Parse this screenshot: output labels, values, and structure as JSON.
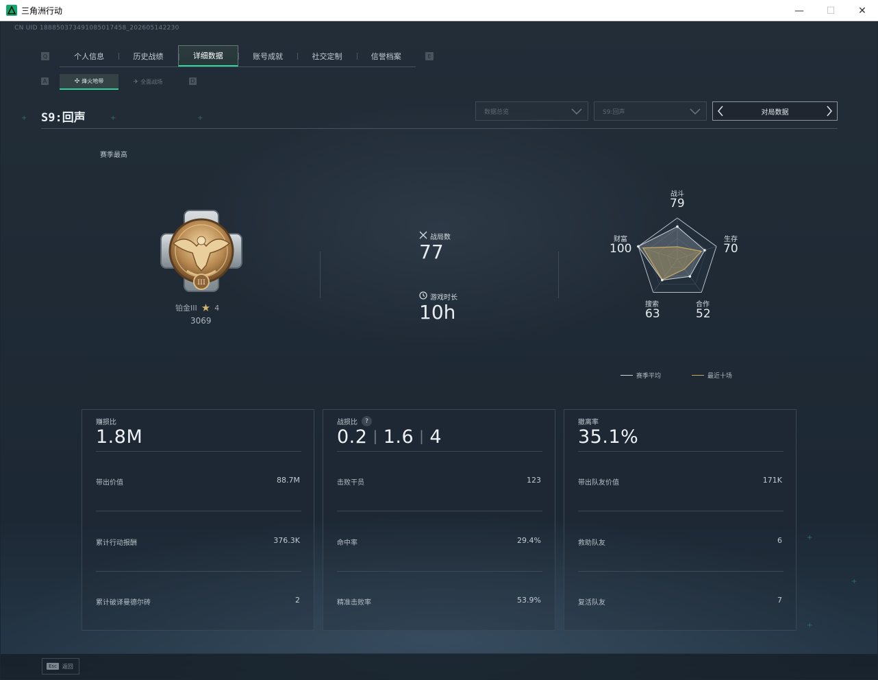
{
  "window": {
    "title": "三角洲行动",
    "minimize": "—",
    "maximize": "☐",
    "close": "✕"
  },
  "uid": "CN UID 188850373491085017458_202605142230",
  "key_hints": {
    "left_main": "Q",
    "right_main": "E",
    "left_sub": "A",
    "right_sub": "D"
  },
  "main_tabs": [
    {
      "label": "个人信息",
      "active": false
    },
    {
      "label": "历史战绩",
      "active": false
    },
    {
      "label": "详细数据",
      "active": true
    },
    {
      "label": "账号成就",
      "active": false
    },
    {
      "label": "社交定制",
      "active": false
    },
    {
      "label": "信誉档案",
      "active": false
    }
  ],
  "sub_tabs": [
    {
      "label": "烽火地带",
      "icon": "crosshair-icon",
      "active": true
    },
    {
      "label": "全面战场",
      "icon": "plane-icon",
      "active": false
    }
  ],
  "season": {
    "title": "S9:回声"
  },
  "filters": {
    "data_select": "数据总览",
    "season_select": "S9:回声",
    "match_button": "对局数据"
  },
  "season_best_label": "赛季最高",
  "rank": {
    "name": "铂金III",
    "stars": "4",
    "points": "3069"
  },
  "stats": {
    "matches_label": "战局数",
    "matches_value": "77",
    "playtime_label": "游戏时长",
    "playtime_value": "10h"
  },
  "radar": {
    "axes": [
      {
        "label": "战斗",
        "value": "79"
      },
      {
        "label": "生存",
        "value": "70"
      },
      {
        "label": "合作",
        "value": "52"
      },
      {
        "label": "搜索",
        "value": "63"
      },
      {
        "label": "财富",
        "value": "100"
      }
    ],
    "season_avg": [
      0.79,
      0.7,
      0.52,
      0.63,
      1.0
    ],
    "recent_ten": [
      0.3,
      0.62,
      0.3,
      0.62,
      0.88
    ],
    "legend": [
      {
        "label": "赛季平均",
        "color": "#d0d6da"
      },
      {
        "label": "最近十场",
        "color": "#c9aa60"
      }
    ]
  },
  "cards": [
    {
      "title": "赚损比",
      "big": "1.8M",
      "rows": [
        {
          "label": "带出价值",
          "value": "88.7M"
        },
        {
          "label": "累计行动报酬",
          "value": "376.3K"
        },
        {
          "label": "累计破译曼德尔砖",
          "value": "2"
        }
      ]
    },
    {
      "title": "战损比",
      "help": "?",
      "big_parts": [
        "0.2",
        "1.6",
        "4"
      ],
      "rows": [
        {
          "label": "击败干员",
          "value": "123"
        },
        {
          "label": "命中率",
          "value": "29.4%"
        },
        {
          "label": "精准击败率",
          "value": "53.9%"
        }
      ]
    },
    {
      "title": "撤离率",
      "big": "35.1%",
      "rows": [
        {
          "label": "带出队友价值",
          "value": "171K"
        },
        {
          "label": "救助队友",
          "value": "6"
        },
        {
          "label": "复活队友",
          "value": "7"
        }
      ]
    }
  ],
  "footer": {
    "esc_key": "Esc",
    "esc_label": "返回"
  }
}
